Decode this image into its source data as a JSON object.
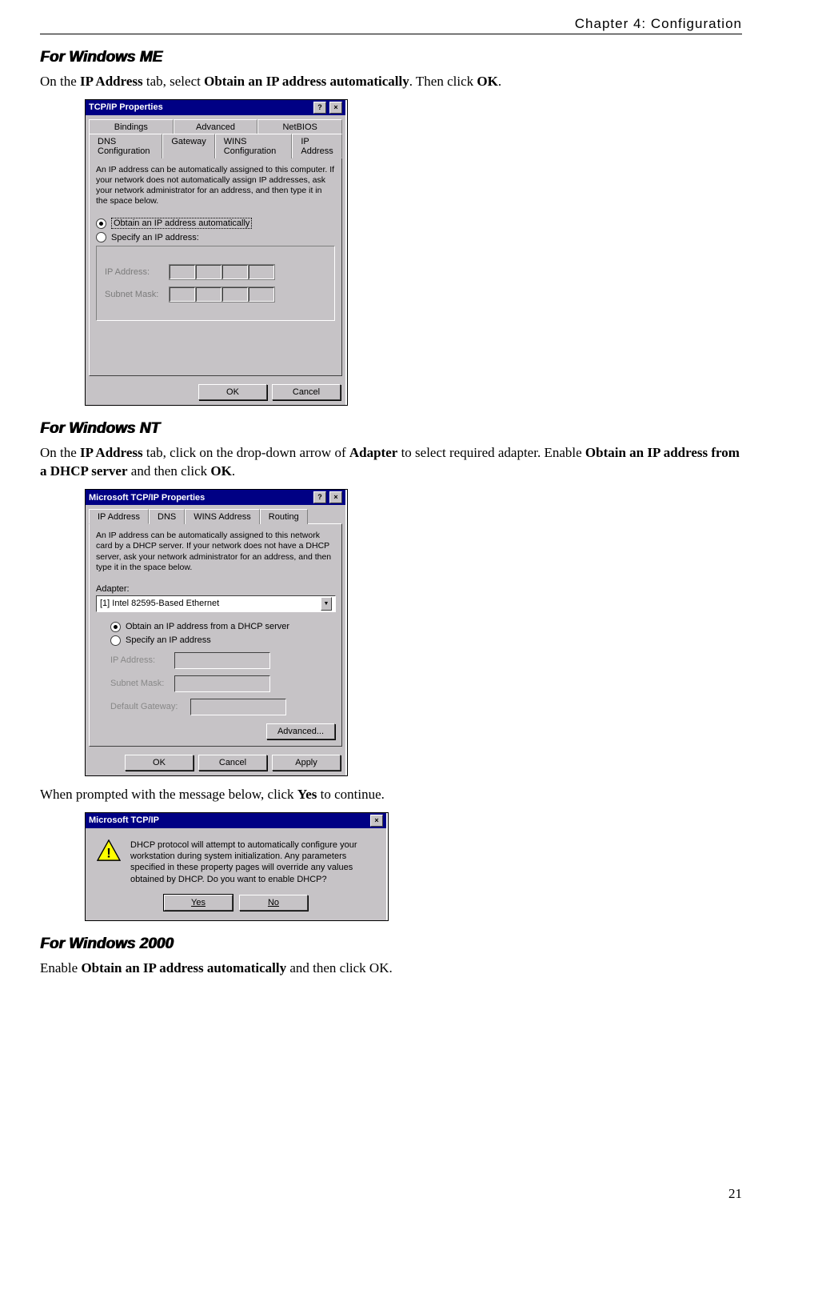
{
  "header": {
    "chapter": "Chapter 4: Configuration"
  },
  "page_number": "21",
  "sections": {
    "me": {
      "heading": "For Windows ME",
      "para_parts": [
        "On the ",
        "IP Address",
        " tab, select ",
        "Obtain an IP address automatically",
        ". Then click ",
        "OK",
        "."
      ]
    },
    "nt": {
      "heading": "For Windows NT",
      "para_parts": [
        "On the ",
        "IP Address",
        " tab, click on the drop-down arrow of ",
        "Adapter",
        " to select required adapter. Enable ",
        "Obtain an IP address from a DHCP server",
        " and then click ",
        "OK",
        "."
      ],
      "after": [
        "When prompted with the message below, click ",
        "Yes",
        " to continue."
      ]
    },
    "w2k": {
      "heading": "For Windows 2000",
      "para_parts": [
        "Enable ",
        "Obtain an IP address automatically",
        " and then click OK."
      ]
    }
  },
  "dlg_me": {
    "title": "TCP/IP Properties",
    "tabs_row1": [
      "Bindings",
      "Advanced",
      "NetBIOS"
    ],
    "tabs_row2": [
      "DNS Configuration",
      "Gateway",
      "WINS Configuration",
      "IP Address"
    ],
    "info": "An IP address can be automatically assigned to this computer. If your network does not automatically assign IP addresses, ask your network administrator for an address, and then type it in the space below.",
    "radio_auto": "Obtain an IP address automatically",
    "radio_spec": "Specify an IP address:",
    "lbl_ip": "IP Address:",
    "lbl_mask": "Subnet Mask:",
    "btn_ok": "OK",
    "btn_cancel": "Cancel"
  },
  "dlg_nt": {
    "title": "Microsoft TCP/IP Properties",
    "tabs": [
      "IP Address",
      "DNS",
      "WINS Address",
      "Routing"
    ],
    "info": "An IP address can be automatically assigned to this network card by a DHCP server. If your network does not have a DHCP server, ask your network administrator for an address, and then type it in the space below.",
    "lbl_adapter": "Adapter:",
    "adapter_value": "[1] Intel 82595-Based Ethernet",
    "radio_auto": "Obtain an IP address from a DHCP server",
    "radio_spec": "Specify an IP address",
    "lbl_ip": "IP Address:",
    "lbl_mask": "Subnet Mask:",
    "lbl_gw": "Default Gateway:",
    "btn_adv": "Advanced...",
    "btn_ok": "OK",
    "btn_cancel": "Cancel",
    "btn_apply": "Apply"
  },
  "msg": {
    "title": "Microsoft TCP/IP",
    "text": "DHCP protocol will attempt to automatically configure your workstation during system initialization. Any parameters specified in these property pages will override any values obtained by DHCP. Do you want to enable DHCP?",
    "btn_yes": "Yes",
    "btn_no": "No"
  }
}
